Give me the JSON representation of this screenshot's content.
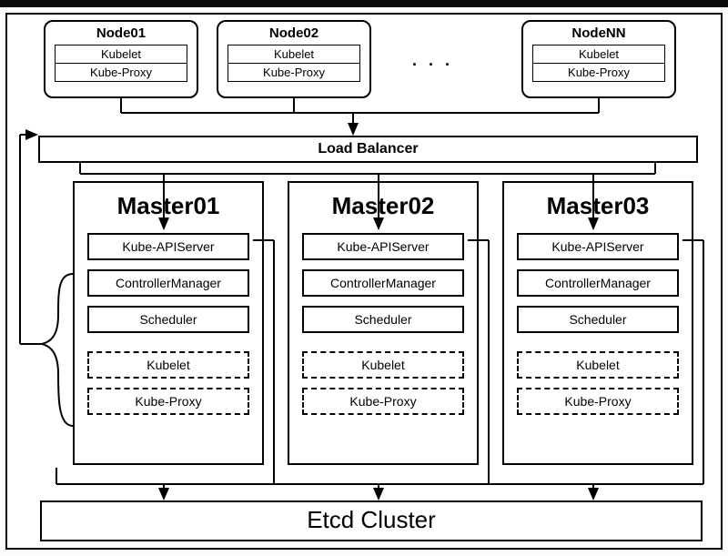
{
  "nodes": [
    {
      "title": "Node01",
      "slots": [
        "Kubelet",
        "Kube-Proxy"
      ]
    },
    {
      "title": "Node02",
      "slots": [
        "Kubelet",
        "Kube-Proxy"
      ]
    },
    {
      "title": "NodeNN",
      "slots": [
        "Kubelet",
        "Kube-Proxy"
      ]
    }
  ],
  "ellipsis": ". . .",
  "load_balancer": {
    "label": "Load Balancer"
  },
  "masters": [
    {
      "title": "Master01",
      "solid": [
        "Kube-APIServer",
        "ControllerManager",
        "Scheduler"
      ],
      "dashed": [
        "Kubelet",
        "Kube-Proxy"
      ]
    },
    {
      "title": "Master02",
      "solid": [
        "Kube-APIServer",
        "ControllerManager",
        "Scheduler"
      ],
      "dashed": [
        "Kubelet",
        "Kube-Proxy"
      ]
    },
    {
      "title": "Master03",
      "solid": [
        "Kube-APIServer",
        "ControllerManager",
        "Scheduler"
      ],
      "dashed": [
        "Kubelet",
        "Kube-Proxy"
      ]
    }
  ],
  "etcd": {
    "label": "Etcd Cluster"
  },
  "chart_data": {
    "type": "architecture-diagram",
    "description": "Kubernetes HA cluster topology",
    "layers": [
      {
        "layer": "workers",
        "boxes": [
          "Node01",
          "Node02",
          "NodeNN"
        ],
        "note": "ellipsis indicates more nodes"
      },
      {
        "layer": "load-balancer",
        "boxes": [
          "Load Balancer"
        ]
      },
      {
        "layer": "masters",
        "boxes": [
          "Master01",
          "Master02",
          "Master03"
        ]
      },
      {
        "layer": "datastore",
        "boxes": [
          "Etcd Cluster"
        ]
      }
    ],
    "edges": [
      {
        "from": "Node01",
        "to": "Load Balancer",
        "dir": "down"
      },
      {
        "from": "Node02",
        "to": "Load Balancer",
        "dir": "down"
      },
      {
        "from": "NodeNN",
        "to": "Load Balancer",
        "dir": "down"
      },
      {
        "from": "Load Balancer",
        "to": "Master01.Kube-APIServer",
        "dir": "down"
      },
      {
        "from": "Load Balancer",
        "to": "Master02.Kube-APIServer",
        "dir": "down"
      },
      {
        "from": "Load Balancer",
        "to": "Master03.Kube-APIServer",
        "dir": "down"
      },
      {
        "from": "Master01",
        "to": "Etcd Cluster",
        "dir": "down"
      },
      {
        "from": "Master02",
        "to": "Etcd Cluster",
        "dir": "down"
      },
      {
        "from": "Master03",
        "to": "Etcd Cluster",
        "dir": "down"
      },
      {
        "from": "Master01(components-bracket)",
        "to": "Load Balancer",
        "dir": "up-left-loop"
      }
    ]
  }
}
